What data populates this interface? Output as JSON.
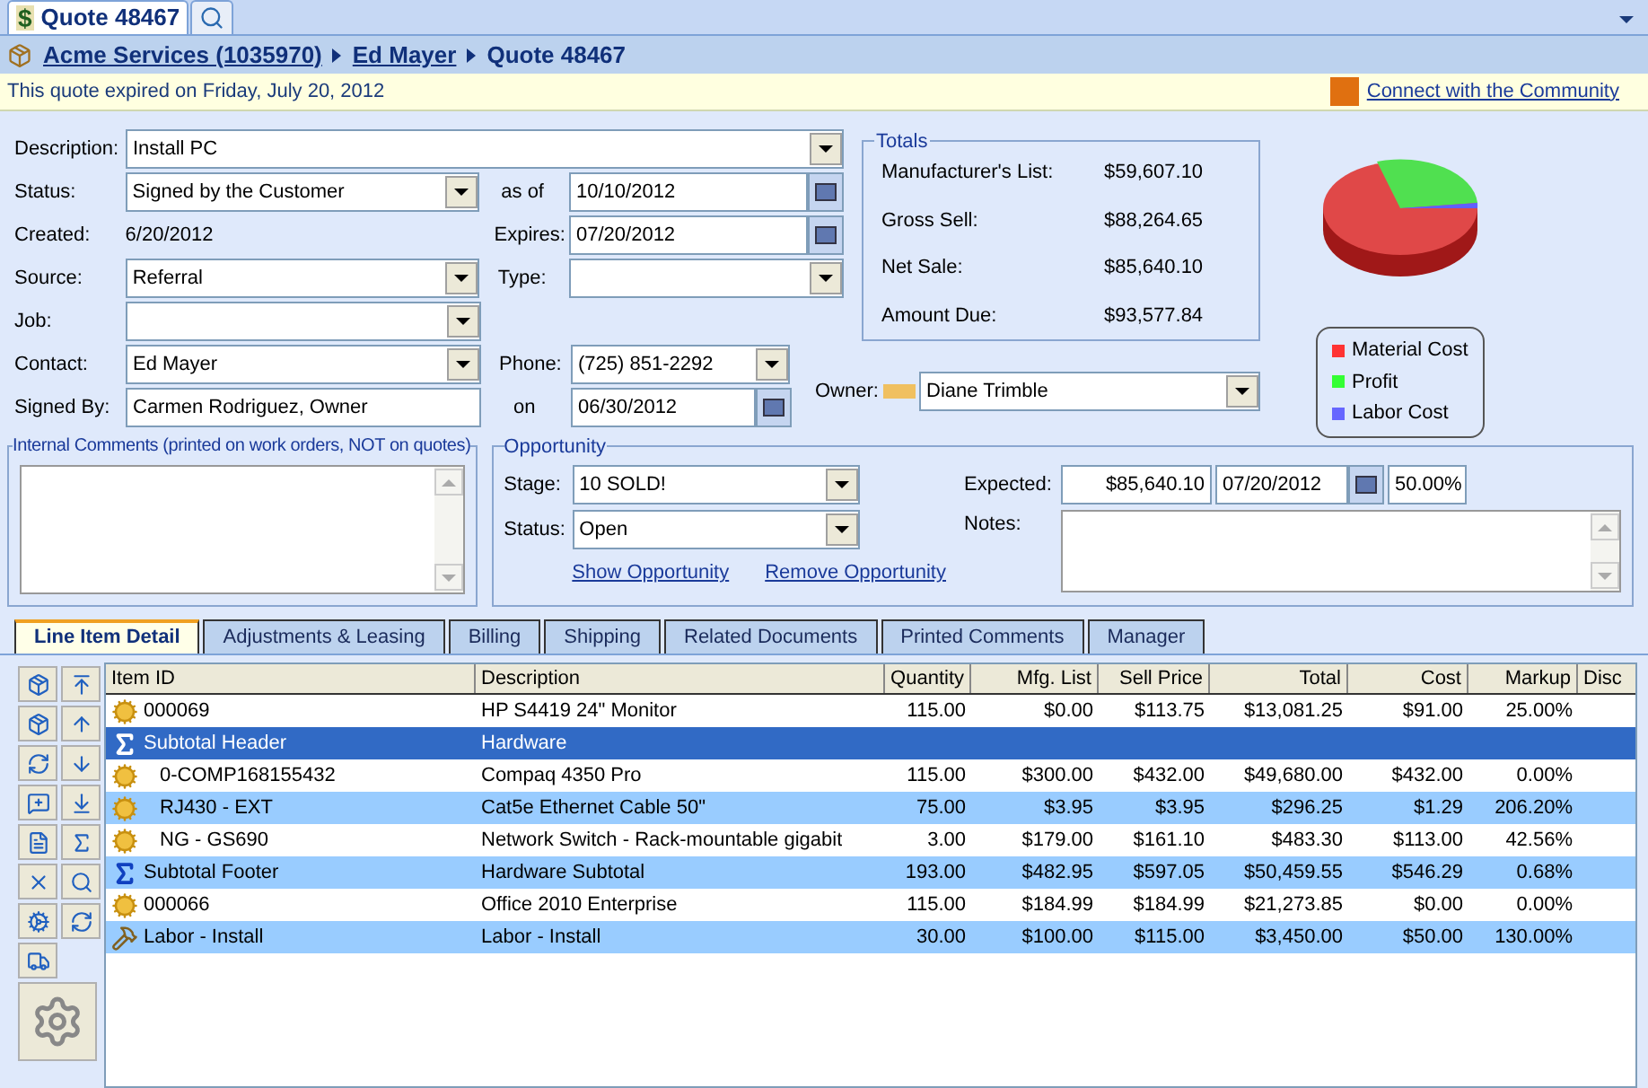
{
  "doc_tabs": [
    {
      "label": "Quote 48467",
      "icon": "$",
      "kind": "quote",
      "selected": true
    },
    {
      "kind": "search",
      "selected": false
    }
  ],
  "breadcrumb": [
    {
      "label": "Acme Services (1035970)",
      "link": true
    },
    {
      "label": "Ed Mayer",
      "link": true
    },
    {
      "label": "Quote 48467",
      "link": false
    }
  ],
  "banner": {
    "message": "This quote expired on Friday, July 20, 2012",
    "community_link": "Connect with the Community"
  },
  "form": {
    "description": {
      "label": "Description:",
      "value": "Install PC"
    },
    "status": {
      "label": "Status:",
      "value": "Signed by the Customer"
    },
    "as_of": {
      "label": "as of",
      "value": "10/10/2012"
    },
    "created": {
      "label": "Created:",
      "value": "6/20/2012"
    },
    "expires": {
      "label": "Expires:",
      "value": "07/20/2012"
    },
    "source": {
      "label": "Source:",
      "value": "Referral"
    },
    "type": {
      "label": "Type:"
    },
    "job": {
      "label": "Job:"
    },
    "contact": {
      "label": "Contact:",
      "value": "Ed Mayer"
    },
    "phone": {
      "label": "Phone:",
      "value": "(725) 851-2292"
    },
    "owner": {
      "label": "Owner:",
      "value": "Diane Trimble"
    },
    "signed_by": {
      "label": "Signed By:",
      "value": "Carmen Rodriguez, Owner"
    },
    "on": {
      "label": "on",
      "value": "06/30/2012"
    }
  },
  "totals": {
    "title": "Totals",
    "rows": [
      {
        "label": "Manufacturer's List:",
        "value": "$59,607.10"
      },
      {
        "label": "Gross Sell:",
        "value": "$88,264.65"
      },
      {
        "label": "Net Sale:",
        "value": "$85,640.10"
      },
      {
        "label": "Amount Due:",
        "value": "$93,577.84"
      }
    ]
  },
  "legend": [
    {
      "label": "Material Cost",
      "color": "#ff3333"
    },
    {
      "label": "Profit",
      "color": "#33ff33"
    },
    {
      "label": "Labor Cost",
      "color": "#6666ff"
    }
  ],
  "internal_comments": {
    "title": "Internal Comments (printed on work orders, NOT on quotes)"
  },
  "opportunity": {
    "title": "Opportunity",
    "stage_label": "Stage:",
    "stage": "10 SOLD!",
    "status_label": "Status:",
    "status": "Open",
    "expected_label": "Expected:",
    "expected_amount": "$85,640.10",
    "expected_date": "07/20/2012",
    "probability": "50.00%",
    "notes_label": "Notes:",
    "links": [
      "Show Opportunity",
      "Remove Opportunity"
    ]
  },
  "detail_tabs": [
    {
      "label": "Line Item Detail",
      "selected": true
    },
    {
      "label": "Adjustments & Leasing",
      "selected": false
    },
    {
      "label": "Billing",
      "selected": false
    },
    {
      "label": "Shipping",
      "selected": false
    },
    {
      "label": "Related Documents",
      "selected": false
    },
    {
      "label": "Printed Comments",
      "selected": false
    },
    {
      "label": "Manager",
      "selected": false
    }
  ],
  "table": {
    "columns": [
      "Item ID",
      "Description",
      "Quantity",
      "Mfg. List",
      "Sell Price",
      "Total",
      "Cost",
      "Markup",
      "Disc"
    ],
    "rows": [
      {
        "kind": "item",
        "selected": false,
        "cells": [
          "000069",
          "HP S4419 24\" Monitor",
          "115.00",
          "$0.00",
          "$113.75",
          "$13,081.25",
          "$91.00",
          "25.00%"
        ]
      },
      {
        "kind": "subtotal",
        "selected": true,
        "cells": [
          "Subtotal Header",
          "Hardware",
          "",
          "",
          "",
          "",
          "",
          ""
        ],
        "children": [
          {
            "kind": "item",
            "selected": false,
            "cells": [
              "0-COMP168155432",
              "Compaq 4350 Pro",
              "115.00",
              "$300.00",
              "$432.00",
              "$49,680.00",
              "$432.00",
              "0.00%"
            ]
          },
          {
            "kind": "item",
            "selected": false,
            "cells": [
              "RJ430 - EXT",
              "Cat5e Ethernet Cable 50\"",
              "75.00",
              "$3.95",
              "$3.95",
              "$296.25",
              "$1.29",
              "206.20%"
            ]
          },
          {
            "kind": "item",
            "selected": false,
            "cells": [
              "NG - GS690",
              "Network Switch - Rack-mountable gigabit",
              "3.00",
              "$179.00",
              "$161.10",
              "$483.30",
              "$113.00",
              "42.56%"
            ]
          }
        ]
      },
      {
        "kind": "subtotal",
        "selected": false,
        "cells": [
          "Subtotal Footer",
          "Hardware Subtotal",
          "193.00",
          "$482.95",
          "$597.05",
          "$50,459.55",
          "$546.29",
          "0.68%"
        ]
      },
      {
        "kind": "item",
        "selected": false,
        "cells": [
          "000066",
          "Office 2010 Enterprise",
          "115.00",
          "$184.99",
          "$184.99",
          "$21,273.85",
          "$0.00",
          "0.00%"
        ]
      },
      {
        "kind": "labor",
        "selected": false,
        "cells": [
          "Labor - Install",
          "Labor - Install",
          "30.00",
          "$100.00",
          "$115.00",
          "$3,450.00",
          "$50.00",
          "130.00%"
        ]
      }
    ]
  }
}
